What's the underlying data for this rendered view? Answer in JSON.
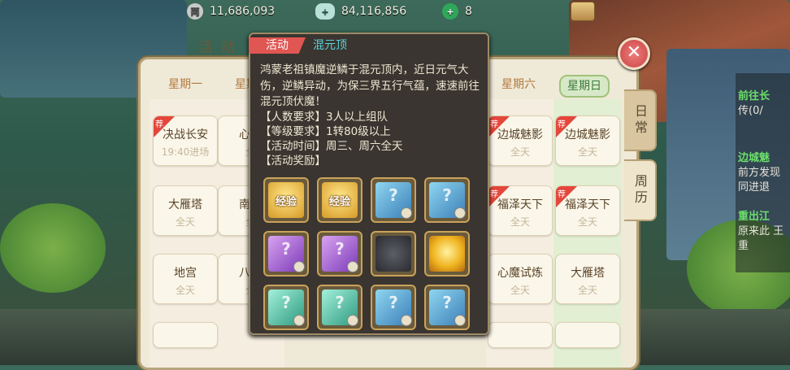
{
  "resources": {
    "silver": {
      "icon": "silver-coin-icon",
      "value": "11,686,093"
    },
    "gold": {
      "icon": "gold-ingot-icon",
      "value": "84,116,856"
    },
    "jade": {
      "icon": "jade-icon",
      "value": "8"
    }
  },
  "panel": {
    "title": "活动",
    "close_icon": "close-icon"
  },
  "days": [
    "星期一",
    "星期",
    "星期六",
    "星期日"
  ],
  "schedule": {
    "mon": [
      {
        "name": "决战长安",
        "time": "19:40进场",
        "rec": "荐"
      },
      {
        "name": "大雁塔",
        "time": "全天"
      },
      {
        "name": "地宫",
        "time": "全天"
      }
    ],
    "tue": [
      {
        "name": "心魔",
        "time": "全"
      },
      {
        "name": "南斗",
        "time": "全"
      },
      {
        "name": "八卦",
        "time": "全"
      }
    ],
    "sat": [
      {
        "name": "边城魅影",
        "time": "全天",
        "rec": "荐"
      },
      {
        "name": "福泽天下",
        "time": "全天",
        "rec": "荐"
      },
      {
        "name": "心魔试炼",
        "time": "全天"
      }
    ],
    "sun": [
      {
        "name": "边城魅影",
        "time": "全天",
        "rec": "荐"
      },
      {
        "name": "福泽天下",
        "time": "全天",
        "rec": "荐"
      },
      {
        "name": "大雁塔",
        "time": "全天"
      }
    ]
  },
  "side_tabs": {
    "daily": "日常",
    "weekly": "周历"
  },
  "popup": {
    "tag": "活动",
    "name": "混元顶",
    "description": "鸿蒙老祖镇魔逆鳞于混元顶内，近日元气大伤，逆鳞异动，为保三界五行气蕴，速速前往混元顶伏魔！",
    "lines": [
      "【人数要求】3人以上组队",
      "【等级要求】1转80级以上",
      "【活动时间】周三、周六全天",
      "【活动奖励】"
    ],
    "rewards": [
      {
        "type": "exp",
        "label": "经验",
        "icon": "exp-scroll-icon"
      },
      {
        "type": "exp",
        "label": "经验",
        "icon": "exp-paw-icon"
      },
      {
        "type": "blue",
        "label": "?",
        "icon": "blue-mystery-card-icon"
      },
      {
        "type": "blue",
        "label": "?",
        "icon": "blue-mystery-card-icon"
      },
      {
        "type": "purple",
        "label": "?",
        "icon": "purple-mystery-card-icon"
      },
      {
        "type": "purple",
        "label": "?",
        "icon": "purple-mystery-card-icon"
      },
      {
        "type": "stone",
        "label": "",
        "icon": "dark-stone-icon"
      },
      {
        "type": "orb",
        "label": "",
        "icon": "golden-orb-icon"
      },
      {
        "type": "teal",
        "label": "?",
        "icon": "teal-mystery-card-icon"
      },
      {
        "type": "teal",
        "label": "?",
        "icon": "teal-mystery-card-icon"
      },
      {
        "type": "blue",
        "label": "?",
        "icon": "blue-mystery-card-icon"
      },
      {
        "type": "blue",
        "label": "?",
        "icon": "blue-mystery-card-icon"
      }
    ]
  },
  "quest_panel": {
    "items": [
      {
        "title": "前往长",
        "desc": "传(0/"
      },
      {
        "title": "边城魅",
        "desc": "前方发现 同进退"
      },
      {
        "title": "重出江",
        "desc": "原来此 王重"
      }
    ]
  }
}
